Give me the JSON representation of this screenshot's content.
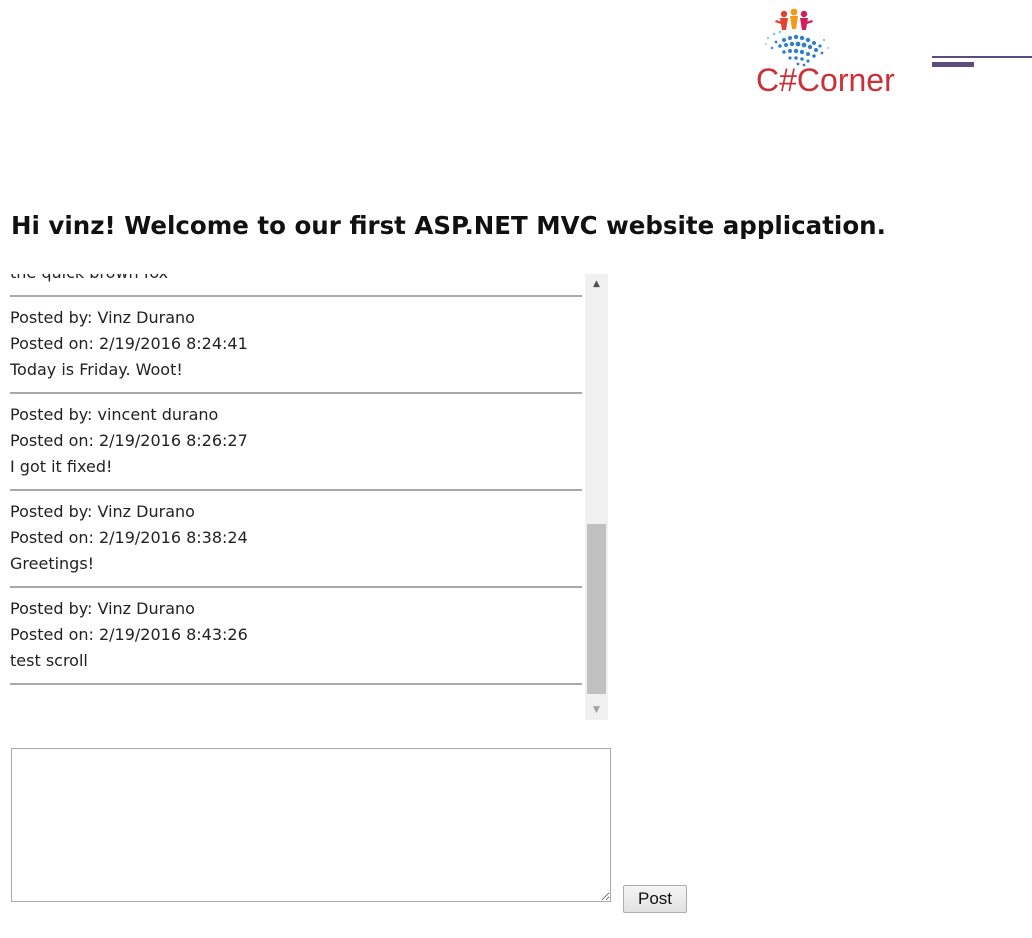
{
  "header": {
    "logo_text": "C#Corner",
    "accent_color": "#cc2f35",
    "line_color": "#5c4d80"
  },
  "page": {
    "title": "Hi vinz! Welcome to our first ASP.NET MVC website application."
  },
  "messages": [
    {
      "text": "the quick brown fox"
    },
    {
      "posted_by": "Posted by: Vinz Durano",
      "posted_on": "Posted on: 2/19/2016 8:24:41",
      "text": "Today is Friday. Woot!"
    },
    {
      "posted_by": "Posted by: vincent durano",
      "posted_on": "Posted on: 2/19/2016 8:26:27",
      "text": "I got it fixed!"
    },
    {
      "posted_by": "Posted by: Vinz Durano",
      "posted_on": "Posted on: 2/19/2016 8:38:24",
      "text": "Greetings!"
    },
    {
      "posted_by": "Posted by: Vinz Durano",
      "posted_on": "Posted on: 2/19/2016 8:43:26",
      "text": "test scroll"
    }
  ],
  "scrollbar": {
    "up_icon": "▲",
    "down_icon": "▼"
  },
  "composer": {
    "value": "",
    "post_label": "Post"
  }
}
